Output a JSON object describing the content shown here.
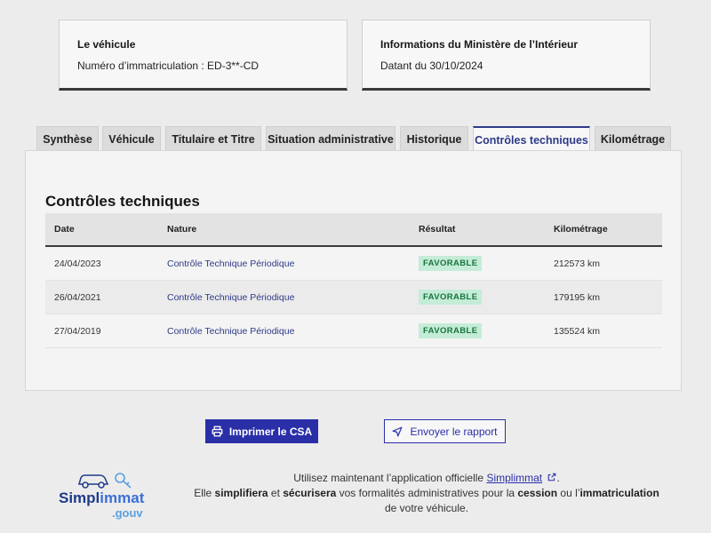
{
  "vehicle_card": {
    "title": "Le véhicule",
    "plate_text": "Numéro d’immatriculation : ED-3**-CD"
  },
  "info_card": {
    "title": "Informations du Ministère de l’Intérieur",
    "date_text": "Datant du 30/10/2024"
  },
  "tabs": [
    {
      "label": "Synthèse"
    },
    {
      "label": "Véhicule"
    },
    {
      "label": "Titulaire et Titre"
    },
    {
      "label": "Situation administrative"
    },
    {
      "label": "Historique"
    },
    {
      "label": "Contrôles techniques"
    },
    {
      "label": "Kilométrage"
    }
  ],
  "active_tab": "Contrôles techniques",
  "section_title": "Contrôles techniques",
  "table": {
    "headers": {
      "date": "Date",
      "nature": "Nature",
      "result": "Résultat",
      "km": "Kilométrage"
    },
    "rows": [
      {
        "date": "24/04/2023",
        "nature": "Contrôle Technique Périodique",
        "result": "FAVORABLE",
        "km": "212573 km"
      },
      {
        "date": "26/04/2021",
        "nature": "Contrôle Technique Périodique",
        "result": "FAVORABLE",
        "km": "179195 km"
      },
      {
        "date": "27/04/2019",
        "nature": "Contrôle Technique Périodique",
        "result": "FAVORABLE",
        "km": "135524 km"
      }
    ]
  },
  "buttons": {
    "print": "Imprimer le CSA",
    "send": "Envoyer le rapport"
  },
  "footer": {
    "line1_prefix": "Utilisez maintenant l’application officielle ",
    "link": "Simplimmat",
    "line1_suffix": ".",
    "line2_p1": "Elle ",
    "line2_b1": "simplifiera",
    "line2_p2": " et ",
    "line2_b2": "sécurisera",
    "line2_p3": " vos formalités administratives pour la ",
    "line2_b3": "cession",
    "line2_p4": " ou l’",
    "line2_b4": "immatriculation",
    "line2_p5": " de votre véhicule."
  },
  "logo": {
    "part1": "Simpl",
    "part2": "immat",
    "suffix": ".gouv"
  },
  "colors": {
    "primary": "#2a2fa8",
    "success_bg": "#c4ecd7",
    "success_text": "#18753c"
  }
}
